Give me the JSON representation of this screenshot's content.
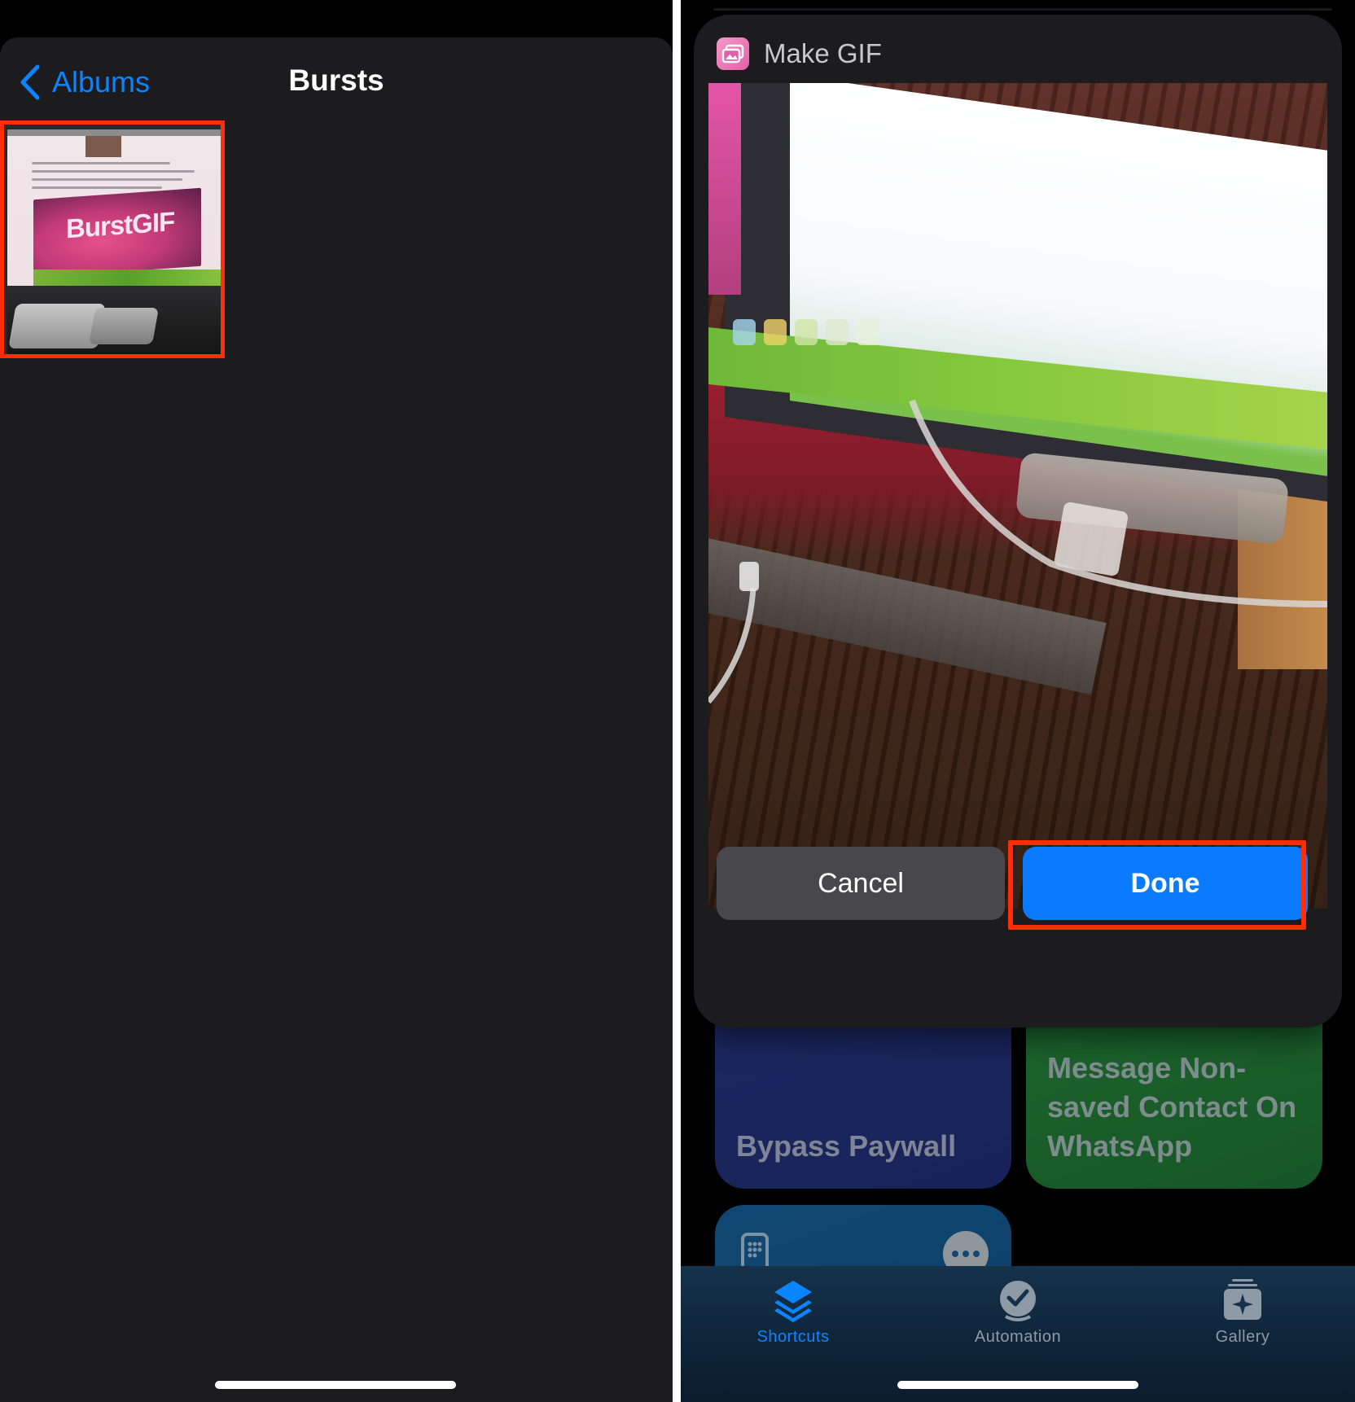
{
  "left_panel": {
    "nav": {
      "back_label": "Albums",
      "title": "Bursts"
    },
    "burst_thumbnail": {
      "overlay_text": "BurstGIF",
      "highlight_color": "#ff2d0a"
    }
  },
  "right_panel": {
    "sheet": {
      "title": "Make GIF",
      "app_icon": "photos-stack-icon",
      "cancel_label": "Cancel",
      "done_label": "Done"
    },
    "tiles": [
      {
        "title": "Bypass Paywall",
        "color": "#2e3f9a"
      },
      {
        "title": "Message Non-saved Contact On WhatsApp",
        "color": "#2e9e47"
      },
      {
        "title": "",
        "color": "#1a6fb0",
        "icon": "remote-icon"
      }
    ],
    "tabbar": {
      "tabs": [
        {
          "label": "Shortcuts",
          "icon": "stacked-layers-icon",
          "active": true
        },
        {
          "label": "Automation",
          "icon": "checkmark-clock-icon",
          "active": false
        },
        {
          "label": "Gallery",
          "icon": "sparkle-stack-icon",
          "active": false
        }
      ]
    }
  },
  "colors": {
    "accent": "#0a84ff",
    "highlight": "#ff2d0a",
    "sheet_bg": "#1c1c1e"
  }
}
